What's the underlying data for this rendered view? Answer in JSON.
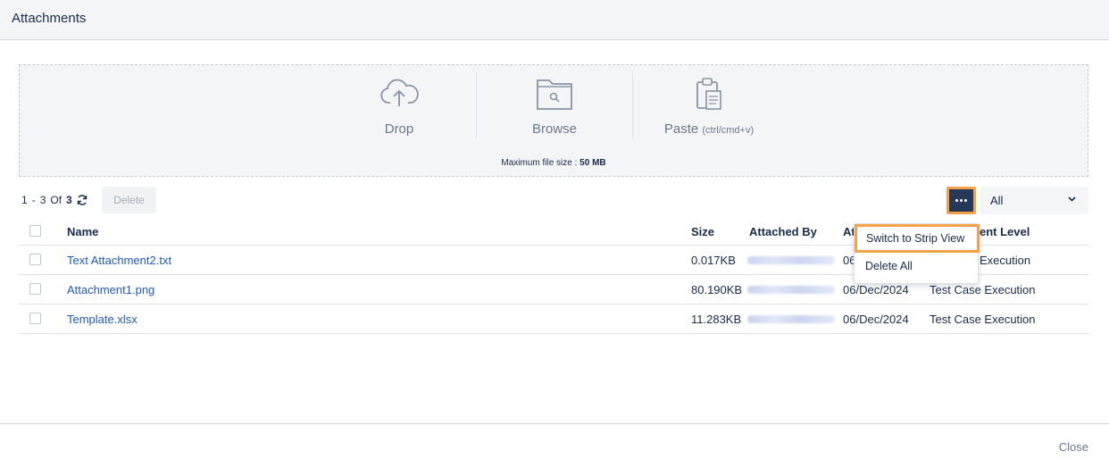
{
  "dialog": {
    "title": "Attachments",
    "close_label": "Close"
  },
  "dropzone": {
    "drop_label": "Drop",
    "browse_label": "Browse",
    "paste_label": "Paste",
    "paste_hint": "(ctrl/cmd+v)",
    "max_size_label": "Maximum file size :",
    "max_size_value": "50 MB"
  },
  "toolbar": {
    "range_start": "1",
    "range_dash": "-",
    "range_end": "3",
    "of_label": "Of",
    "total": "3",
    "delete_label": "Delete",
    "filter_value": "All"
  },
  "table": {
    "headers": {
      "name": "Name",
      "size": "Size",
      "attached_by": "Attached By",
      "attached_on": "At",
      "level": "ent Level"
    },
    "rows": [
      {
        "name": "Text Attachment2.txt",
        "size": "0.017KB",
        "date": "06",
        "level": "Execution"
      },
      {
        "name": "Attachment1.png",
        "size": "80.190KB",
        "date": "06/Dec/2024",
        "level": "Test Case Execution"
      },
      {
        "name": "Template.xlsx",
        "size": "11.283KB",
        "date": "06/Dec/2024",
        "level": "Test Case Execution"
      }
    ]
  },
  "menu": {
    "items": [
      "Switch to Strip View",
      "Delete All"
    ]
  },
  "colors": {
    "accent_dark": "#253858",
    "highlight": "#f5a04a",
    "link": "#1e5bb8"
  },
  "icons": {
    "upload": "cloud-upload-icon",
    "browse": "folder-search-icon",
    "paste": "clipboard-icon",
    "refresh": "refresh-icon",
    "more": "more-dots-icon",
    "chevron": "chevron-down-icon"
  }
}
